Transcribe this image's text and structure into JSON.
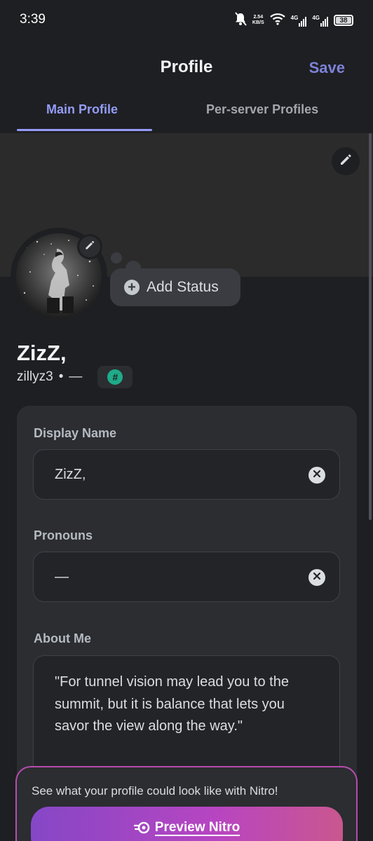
{
  "status_bar": {
    "time": "3:39",
    "speed_value": "2.54",
    "speed_unit": "KB/S",
    "net1": "4G",
    "net2": "4G",
    "battery": "38"
  },
  "header": {
    "title": "Profile",
    "save_label": "Save"
  },
  "tabs": {
    "main": "Main Profile",
    "per_server": "Per-server Profiles"
  },
  "status": {
    "add_label": "Add Status"
  },
  "profile": {
    "display_name": "ZizZ,",
    "username": "zillyz3",
    "separator": "•",
    "pronouns_short": "—",
    "badge": "#"
  },
  "form": {
    "display_name_label": "Display Name",
    "display_name_value": "ZizZ,",
    "pronouns_label": "Pronouns",
    "pronouns_value": "—",
    "about_label": "About Me",
    "about_value": "\"For tunnel vision may lead you to the summit, but it is balance that lets you savor the view along the way.\""
  },
  "nitro": {
    "promo": "See what your profile could look like with Nitro!",
    "button": "Preview Nitro"
  },
  "colors": {
    "accent": "#949cf7",
    "background": "#1e1f22",
    "card": "#2b2d31",
    "badge": "#1fab89",
    "nitro_start": "#8547c6",
    "nitro_end": "#c9578e"
  }
}
